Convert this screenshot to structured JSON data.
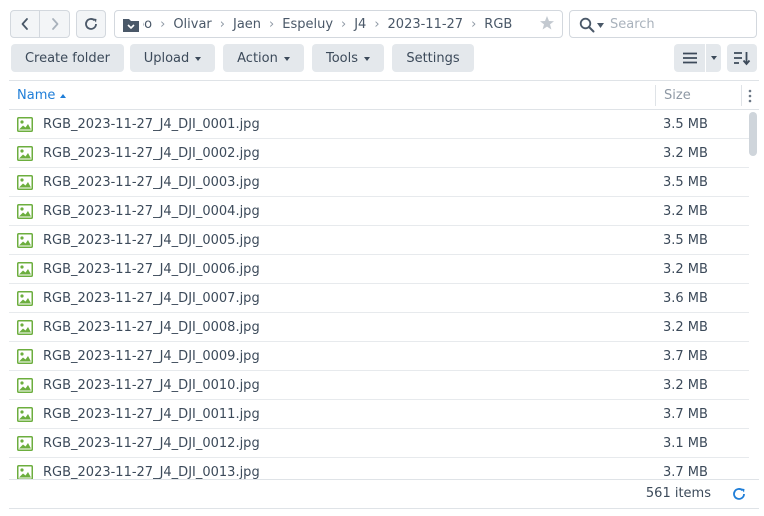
{
  "navigation": {
    "breadcrumbs": [
      "Olivar",
      "Jaen",
      "Espeluy",
      "J4",
      "2023-11-27",
      "RGB"
    ],
    "breadcrumb_cut": "ɔo",
    "search_placeholder": "Search"
  },
  "toolbar": {
    "create_folder": "Create folder",
    "upload": "Upload",
    "action": "Action",
    "tools": "Tools",
    "settings": "Settings"
  },
  "table": {
    "col_name": "Name",
    "col_size": "Size",
    "sort": "name-ascending",
    "rows": [
      {
        "name": "RGB_2023-11-27_J4_DJI_0001.jpg",
        "size": "3.5 MB"
      },
      {
        "name": "RGB_2023-11-27_J4_DJI_0002.jpg",
        "size": "3.2 MB"
      },
      {
        "name": "RGB_2023-11-27_J4_DJI_0003.jpg",
        "size": "3.5 MB"
      },
      {
        "name": "RGB_2023-11-27_J4_DJI_0004.jpg",
        "size": "3.2 MB"
      },
      {
        "name": "RGB_2023-11-27_J4_DJI_0005.jpg",
        "size": "3.5 MB"
      },
      {
        "name": "RGB_2023-11-27_J4_DJI_0006.jpg",
        "size": "3.2 MB"
      },
      {
        "name": "RGB_2023-11-27_J4_DJI_0007.jpg",
        "size": "3.6 MB"
      },
      {
        "name": "RGB_2023-11-27_J4_DJI_0008.jpg",
        "size": "3.2 MB"
      },
      {
        "name": "RGB_2023-11-27_J4_DJI_0009.jpg",
        "size": "3.7 MB"
      },
      {
        "name": "RGB_2023-11-27_J4_DJI_0010.jpg",
        "size": "3.2 MB"
      },
      {
        "name": "RGB_2023-11-27_J4_DJI_0011.jpg",
        "size": "3.7 MB"
      },
      {
        "name": "RGB_2023-11-27_J4_DJI_0012.jpg",
        "size": "3.1 MB"
      },
      {
        "name": "RGB_2023-11-27_J4_DJI_0013.jpg",
        "size": "3.7 MB"
      }
    ]
  },
  "footer": {
    "item_count": "561 items"
  },
  "icons": {
    "back": "chevron-left-icon",
    "forward": "chevron-right-icon",
    "refresh": "refresh-icon",
    "folder": "folder-icon",
    "favorite": "star-icon",
    "search": "search-icon",
    "list_view": "list-view-icon",
    "sort": "sort-icon",
    "column_menu": "kebab-menu-icon",
    "file": "image-file-icon"
  },
  "colors": {
    "accent": "#1f7ed8",
    "image_icon_green": "#6cae3e",
    "button_bg": "#e4e8ec"
  }
}
